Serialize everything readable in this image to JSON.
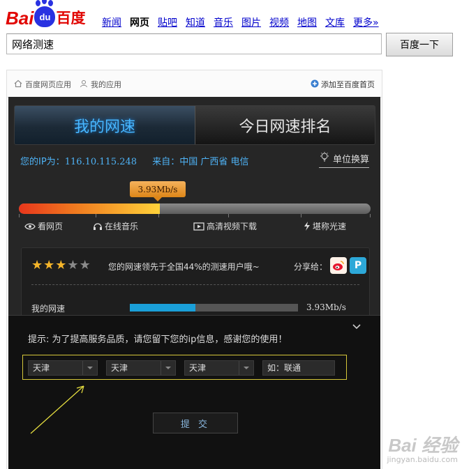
{
  "header": {
    "logo": {
      "left": "Bai",
      "paw": "du",
      "right": "百度"
    },
    "nav": [
      "新闻",
      "网页",
      "贴吧",
      "知道",
      "音乐",
      "图片",
      "视频",
      "地图",
      "文库",
      "更多»"
    ],
    "nav_current": "网页",
    "search_value": "网络测速",
    "search_button": "百度一下"
  },
  "app_bar": {
    "left_1": "百度网页应用",
    "left_2": "我的应用",
    "add_home": "添加至百度首页"
  },
  "tabs": {
    "active": "我的网速",
    "other": "今日网速排名"
  },
  "info": {
    "ip_label": "您的IP为：",
    "ip": "116.10.115.248",
    "from_label": "来自：",
    "location": "中国 广西省 电信",
    "unit_convert": "单位换算"
  },
  "speed": {
    "bubble": "3.93Mb/s",
    "progress_fraction": 0.4,
    "marks": [
      "看网页",
      "在线音乐",
      "高清视频下载",
      "堪称光速"
    ]
  },
  "result": {
    "stars_on": 3,
    "stars_total": 5,
    "lead_text": "您的网速领先于全国44%的测速用户哦~",
    "share_label": "分享给：",
    "my_speed_label": "我的网速",
    "my_speed_value": "3.93Mb/s",
    "my_speed_fraction": 0.39
  },
  "dialog": {
    "collapse": "⌄",
    "tip": "提示: 为了提高服务品质，请您留下您的ip信息，感谢您的使用！",
    "select_1": "天津",
    "select_2": "天津",
    "select_3": "天津",
    "isp_placeholder": "如：联通",
    "submit": "提 交"
  },
  "watermark": {
    "line1": "Bai 经验",
    "line2": "jingyan.baidu.com"
  },
  "colors": {
    "accent_blue": "#47b6ff",
    "bar_orange": "#f07a1f",
    "baidu_red": "#e10602",
    "highlight_border": "#d6c83a"
  }
}
